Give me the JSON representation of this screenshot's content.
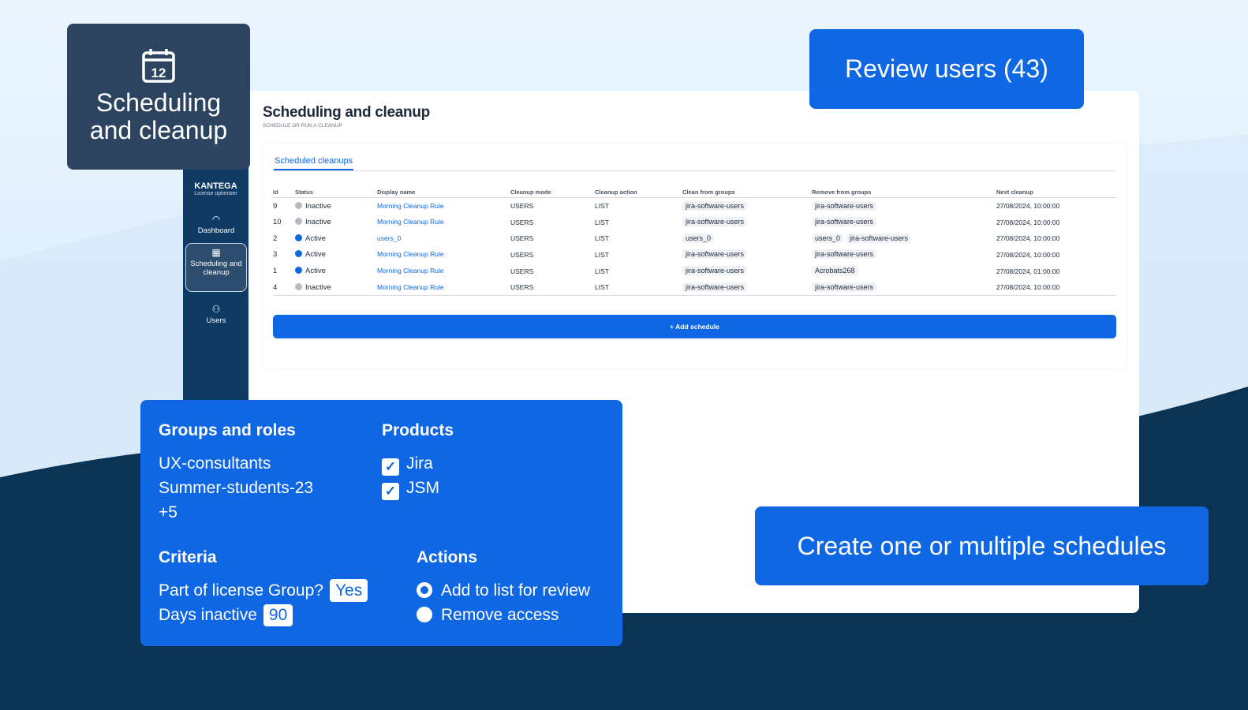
{
  "callouts": {
    "scheduling": "Scheduling and cleanup",
    "review": "Review users (43)",
    "create": "Create one or multiple schedules"
  },
  "sidebar": {
    "brand": "KANTEGA",
    "brand_sub": "License optimiser",
    "items": [
      {
        "label": "Dashboard",
        "icon": "gauge-icon"
      },
      {
        "label": "Scheduling and cleanup",
        "icon": "calendar-icon",
        "active": true
      },
      {
        "label": "Users",
        "icon": "users-icon"
      }
    ]
  },
  "page": {
    "title": "Scheduling and cleanup",
    "subtitle": "SCHEDULE OR RUN A CLEANUP",
    "tab": "Scheduled cleanups",
    "add_button": "+ Add schedule"
  },
  "table": {
    "columns": [
      "Id",
      "Status",
      "Display name",
      "Cleanup mode",
      "Cleanup action",
      "Clean from groups",
      "Remove from groups",
      "Next cleanup"
    ],
    "rows": [
      {
        "id": "9",
        "status": "Inactive",
        "name": "Morning Cleanup Rule",
        "mode": "USERS",
        "action": "LIST",
        "clean": [
          "jira-software-users"
        ],
        "remove": [
          "jira-software-users"
        ],
        "next": "27/08/2024, 10:00:00"
      },
      {
        "id": "10",
        "status": "Inactive",
        "name": "Morning Cleanup Rule",
        "mode": "USERS",
        "action": "LIST",
        "clean": [
          "jira-software-users"
        ],
        "remove": [
          "jira-software-users"
        ],
        "next": "27/08/2024, 10:00:00"
      },
      {
        "id": "2",
        "status": "Active",
        "name": "users_0",
        "mode": "USERS",
        "action": "LIST",
        "clean": [
          "users_0"
        ],
        "remove": [
          "users_0",
          "jira-software-users"
        ],
        "next": "27/08/2024, 10:00:00"
      },
      {
        "id": "3",
        "status": "Active",
        "name": "Morning Cleanup Rule",
        "mode": "USERS",
        "action": "LIST",
        "clean": [
          "jira-software-users"
        ],
        "remove": [
          "jira-software-users"
        ],
        "next": "27/08/2024, 10:00:00"
      },
      {
        "id": "1",
        "status": "Active",
        "name": "Morning Cleanup Rule",
        "mode": "USERS",
        "action": "LIST",
        "clean": [
          "jira-software-users"
        ],
        "remove": [
          "Acrobats268"
        ],
        "next": "27/08/2024, 01:00:00"
      },
      {
        "id": "4",
        "status": "Inactive",
        "name": "Morning Cleanup Rule",
        "mode": "USERS",
        "action": "LIST",
        "clean": [
          "jira-software-users"
        ],
        "remove": [
          "jira-software-users"
        ],
        "next": "27/08/2024, 10:00:00"
      }
    ]
  },
  "panel": {
    "groups_title": "Groups and roles",
    "groups": [
      "UX-consultants",
      "Summer-students-23",
      "+5"
    ],
    "products_title": "Products",
    "products": [
      "Jira",
      "JSM"
    ],
    "criteria_title": "Criteria",
    "criteria_license": "Part of license Group?",
    "criteria_license_value": "Yes",
    "criteria_days": "Days inactive",
    "criteria_days_value": "90",
    "actions_title": "Actions",
    "actions": [
      "Add to list for review",
      "Remove access"
    ]
  },
  "colors": {
    "blue": "#0f67e3",
    "navy": "#0b3354",
    "active": "#1268e0",
    "inactive": "#b5bac3"
  }
}
